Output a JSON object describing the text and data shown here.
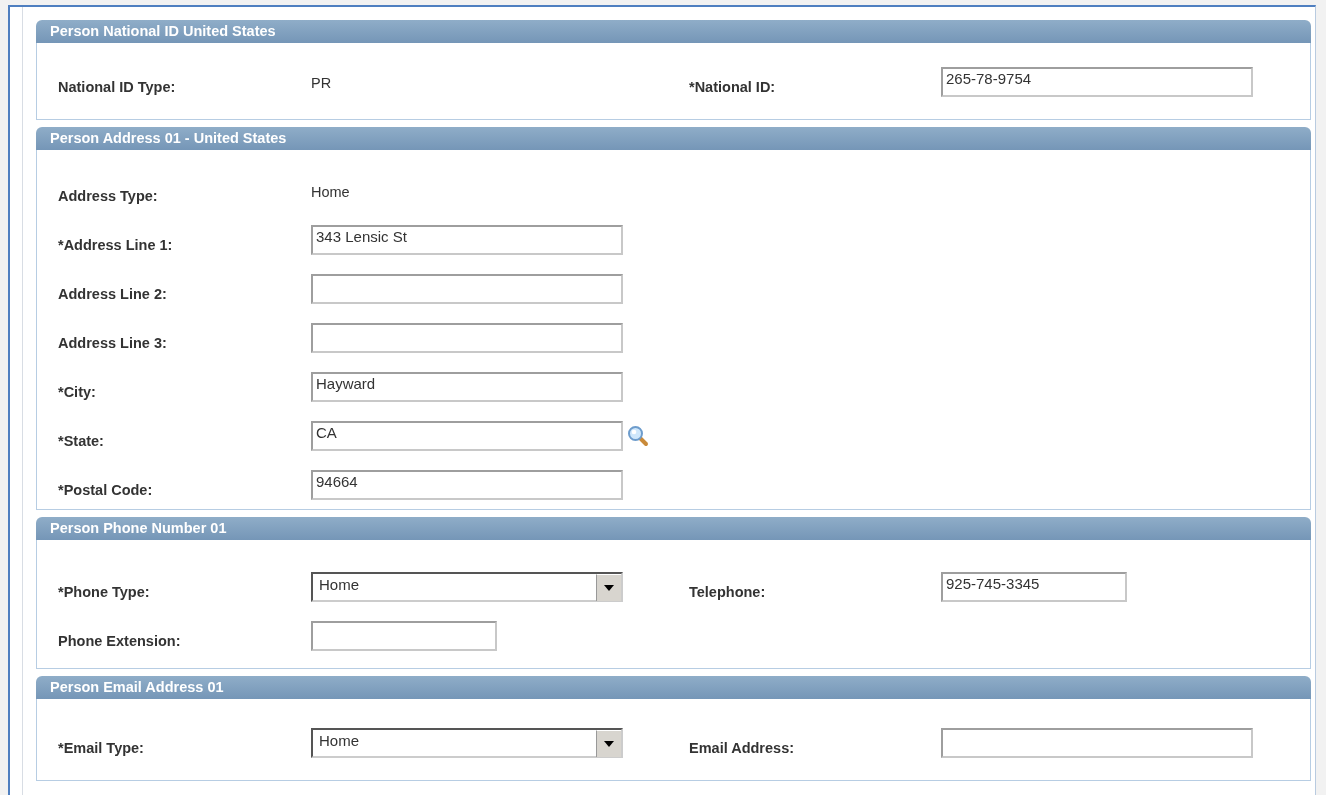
{
  "sections": [
    {
      "title": "Person National ID United States",
      "rows": [
        [
          {
            "label": "National ID Type:",
            "kind": "display",
            "value": "PR"
          },
          {
            "label": "*National ID:",
            "kind": "input",
            "value": "265-78-9754"
          }
        ]
      ]
    },
    {
      "title": "Person Address 01 - United States",
      "rows": [
        [
          {
            "label": "Address Type:",
            "kind": "display",
            "value": "Home"
          }
        ],
        [
          {
            "label": "*Address Line 1:",
            "kind": "input",
            "value": "343 Lensic St"
          }
        ],
        [
          {
            "label": "Address Line 2:",
            "kind": "input"
          }
        ],
        [
          {
            "label": "Address Line 3:",
            "kind": "input"
          }
        ],
        [
          {
            "label": "*City:",
            "kind": "input",
            "value": "Hayward"
          }
        ],
        [
          {
            "label": "*State:",
            "kind": "lookup",
            "value": "CA"
          }
        ],
        [
          {
            "label": "*Postal Code:",
            "kind": "input",
            "value": "94664"
          }
        ]
      ]
    },
    {
      "title": "Person Phone Number 01",
      "rows": [
        [
          {
            "label": "*Phone Type:",
            "kind": "select",
            "value": "Home"
          },
          {
            "label": "Telephone:",
            "kind": "short_input",
            "value": "925-745-3345"
          }
        ],
        [
          {
            "label": "Phone Extension:",
            "kind": "short_input"
          }
        ]
      ]
    },
    {
      "title": "Person Email Address 01",
      "rows": [
        [
          {
            "label": "*Email Type:",
            "kind": "select",
            "value": "Home"
          },
          {
            "label": "Email Address:",
            "kind": "input"
          }
        ]
      ]
    }
  ]
}
